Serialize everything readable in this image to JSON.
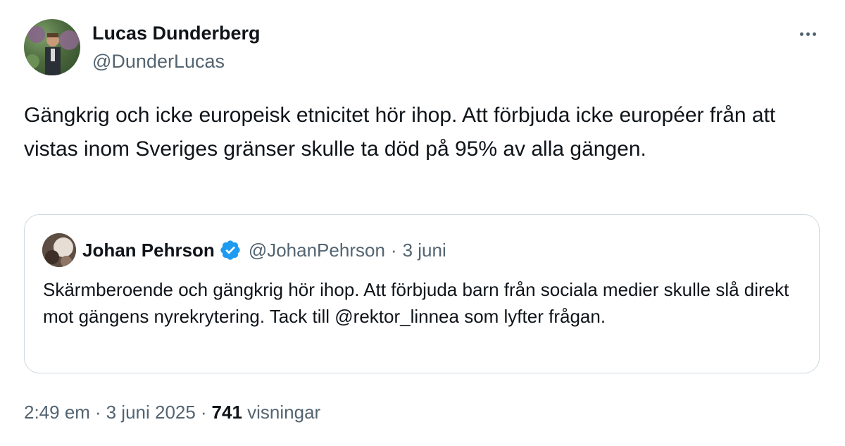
{
  "tweet": {
    "author": {
      "name": "Lucas Dunderberg",
      "handle": "@DunderLucas"
    },
    "text": "Gängkrig och icke europeisk etnicitet hör ihop. Att förbjuda icke européer från att vistas inom Sveriges gränser skulle ta död på 95% av alla gängen.",
    "meta": {
      "time": "2:49 em",
      "sep1": "·",
      "date": "3 juni 2025",
      "sep2": "·",
      "views_count": "741",
      "views_label": "visningar"
    }
  },
  "quoted_tweet": {
    "author": {
      "name": "Johan Pehrson",
      "handle": "@JohanPehrson",
      "verified": true
    },
    "sep": "·",
    "date": "3 juni",
    "text": "Skärmberoende och gängkrig hör ihop. Att förbjuda barn från sociala medier skulle slå direkt mot gängens nyrekrytering. Tack till @rektor_linnea som lyfter frågan."
  },
  "icons": {
    "more": "more-horizontal-icon",
    "verified": "verified-badge-icon"
  },
  "colors": {
    "text": "#0f1419",
    "secondary": "#536471",
    "border": "#cfd9de",
    "verified": "#1d9bf0"
  }
}
